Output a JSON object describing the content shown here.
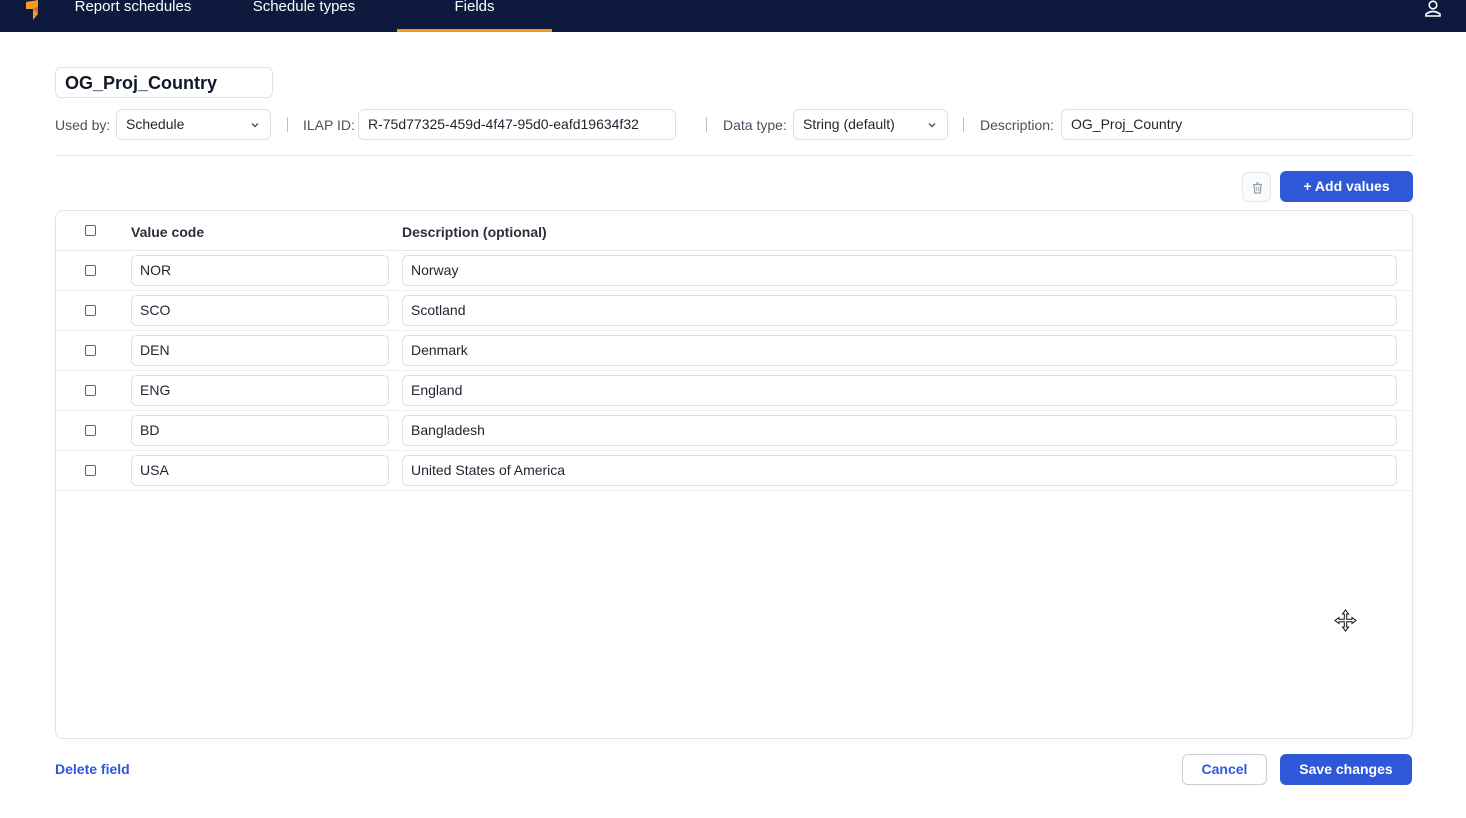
{
  "nav": {
    "tabs": [
      {
        "label": "Report schedules"
      },
      {
        "label": "Schedule types"
      },
      {
        "label": "Fields",
        "active": true
      }
    ],
    "logo_icon": "brand-logo-icon",
    "user_icon": "user-icon"
  },
  "field": {
    "name": "OG_Proj_Country",
    "used_by_label": "Used by:",
    "used_by_value": "Schedule",
    "ilap_label": "ILAP ID:",
    "ilap_value": "R-75d77325-459d-4f47-95d0-eafd19634f32",
    "data_type_label": "Data type:",
    "data_type_value": "String (default)",
    "description_label": "Description:",
    "description_value": "OG_Proj_Country"
  },
  "toolbar": {
    "add_values_label": "+ Add values",
    "delete_icon": "trash-icon"
  },
  "table": {
    "headers": {
      "code": "Value code",
      "description": "Description (optional)"
    },
    "rows": [
      {
        "code": "NOR",
        "description": "Norway"
      },
      {
        "code": "SCO",
        "description": "Scotland"
      },
      {
        "code": "DEN",
        "description": "Denmark"
      },
      {
        "code": "ENG",
        "description": "England"
      },
      {
        "code": "BD",
        "description": "Bangladesh"
      },
      {
        "code": "USA",
        "description": "United States of America"
      }
    ]
  },
  "footer": {
    "delete_field": "Delete field",
    "cancel": "Cancel",
    "save": "Save changes"
  },
  "colors": {
    "nav_bg": "#0d1a3d",
    "accent": "#f29a22",
    "primary": "#2f58d8"
  }
}
